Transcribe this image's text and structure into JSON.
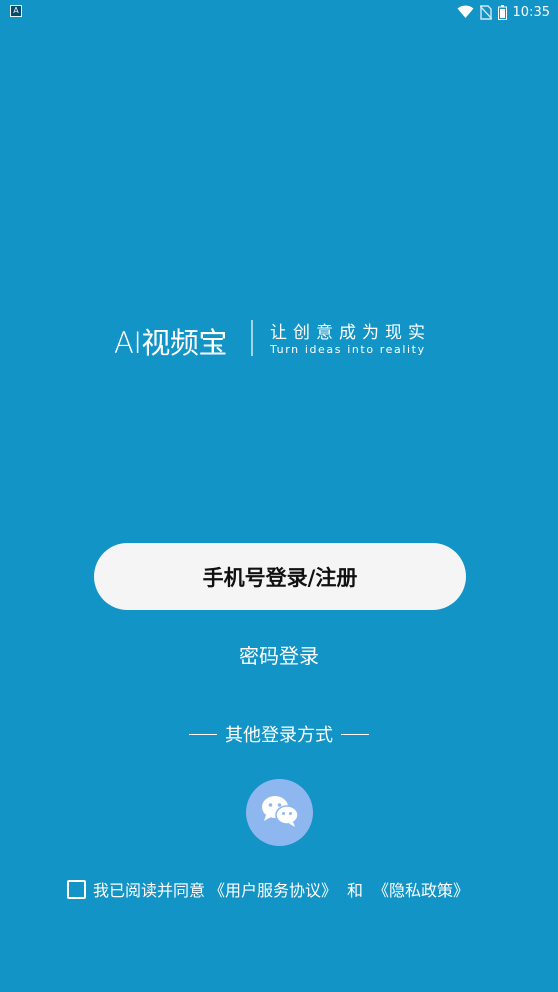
{
  "status_bar": {
    "time": "10:35",
    "notification_icon": "a-letter-icon",
    "icons": [
      "wifi-icon",
      "no-sim-icon",
      "battery-icon"
    ]
  },
  "logo": {
    "app_name": "AI视频宝",
    "slogan_cn": "让创意成为现实",
    "slogan_en": "Turn ideas into reality"
  },
  "login": {
    "phone_button": "手机号登录/注册",
    "password_link": "密码登录",
    "other_methods": "其他登录方式",
    "wechat_icon": "wechat-icon"
  },
  "agreement": {
    "checked": false,
    "prefix": "我已阅读并同意",
    "user_agreement": "《用户服务协议》",
    "and": "和",
    "privacy_policy": "《隐私政策》"
  },
  "colors": {
    "background": "#1294c6",
    "button_bg": "#f5f5f5",
    "wechat_circle": "#8fb7ef"
  }
}
